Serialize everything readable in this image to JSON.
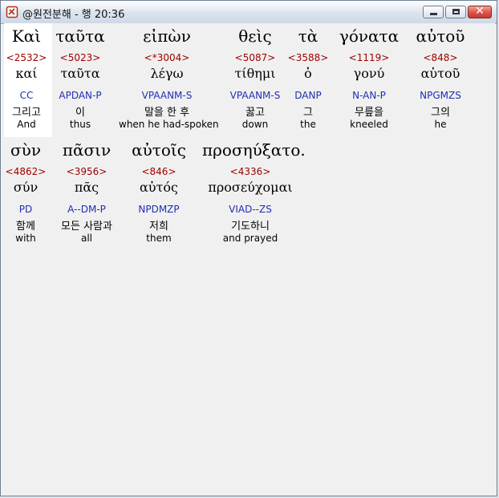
{
  "window": {
    "title": "@원전분해 - 행 20:36"
  },
  "icons": {
    "app": "stamp-icon",
    "minimize": "minimize-icon",
    "maximize": "maximize-icon",
    "close": "close-icon"
  },
  "colors": {
    "strongs": "#a00000",
    "parsing": "#1f2fb5",
    "highlight": "#ffffff"
  },
  "rows": [
    {
      "words": [
        {
          "greek": "Καὶ",
          "strongs": "<2532>",
          "lemma": "καί",
          "parsing": "CC",
          "korean": "그리고",
          "english": "And"
        },
        {
          "greek": "ταῦτα",
          "strongs": "<5023>",
          "lemma": "ταῦτα",
          "parsing": "APDAN-P",
          "korean": "이",
          "english": "thus"
        },
        {
          "greek": "εἰπὼν",
          "strongs": "<*3004>",
          "lemma": "λέγω",
          "parsing": "VPAANM-S",
          "korean": "말을 한 후",
          "english": "when he had-spoken"
        },
        {
          "greek": "θεὶς",
          "strongs": "<5087>",
          "lemma": "τίθημι",
          "parsing": "VPAANM-S",
          "korean": "꿇고",
          "english": "down"
        },
        {
          "greek": "τὰ",
          "strongs": "<3588>",
          "lemma": "ὁ",
          "parsing": "DANP",
          "korean": "그",
          "english": "the"
        },
        {
          "greek": "γόνατα",
          "strongs": "<1119>",
          "lemma": "γονύ",
          "parsing": "N-AN-P",
          "korean": "무릎을",
          "english": "kneeled"
        },
        {
          "greek": "αὐτοῦ",
          "strongs": "<848>",
          "lemma": "αὑτοῦ",
          "parsing": "NPGMZS",
          "korean": "그의",
          "english": "he"
        }
      ]
    },
    {
      "words": [
        {
          "greek": "σὺν",
          "strongs": "<4862>",
          "lemma": "σύν",
          "parsing": "PD",
          "korean": "함께",
          "english": "with"
        },
        {
          "greek": "πᾶσιν",
          "strongs": "<3956>",
          "lemma": "πᾶς",
          "parsing": "A--DM-P",
          "korean": "모든 사람과",
          "english": "all"
        },
        {
          "greek": "αὐτοῖς",
          "strongs": "<846>",
          "lemma": "αὐτός",
          "parsing": "NPDMZP",
          "korean": "저희",
          "english": "them"
        },
        {
          "greek": "προσηύξατο.",
          "strongs": "<4336>",
          "lemma": "προσεύχομαι",
          "parsing": "VIAD--ZS",
          "korean": "기도하니",
          "english": "and prayed"
        }
      ]
    }
  ]
}
